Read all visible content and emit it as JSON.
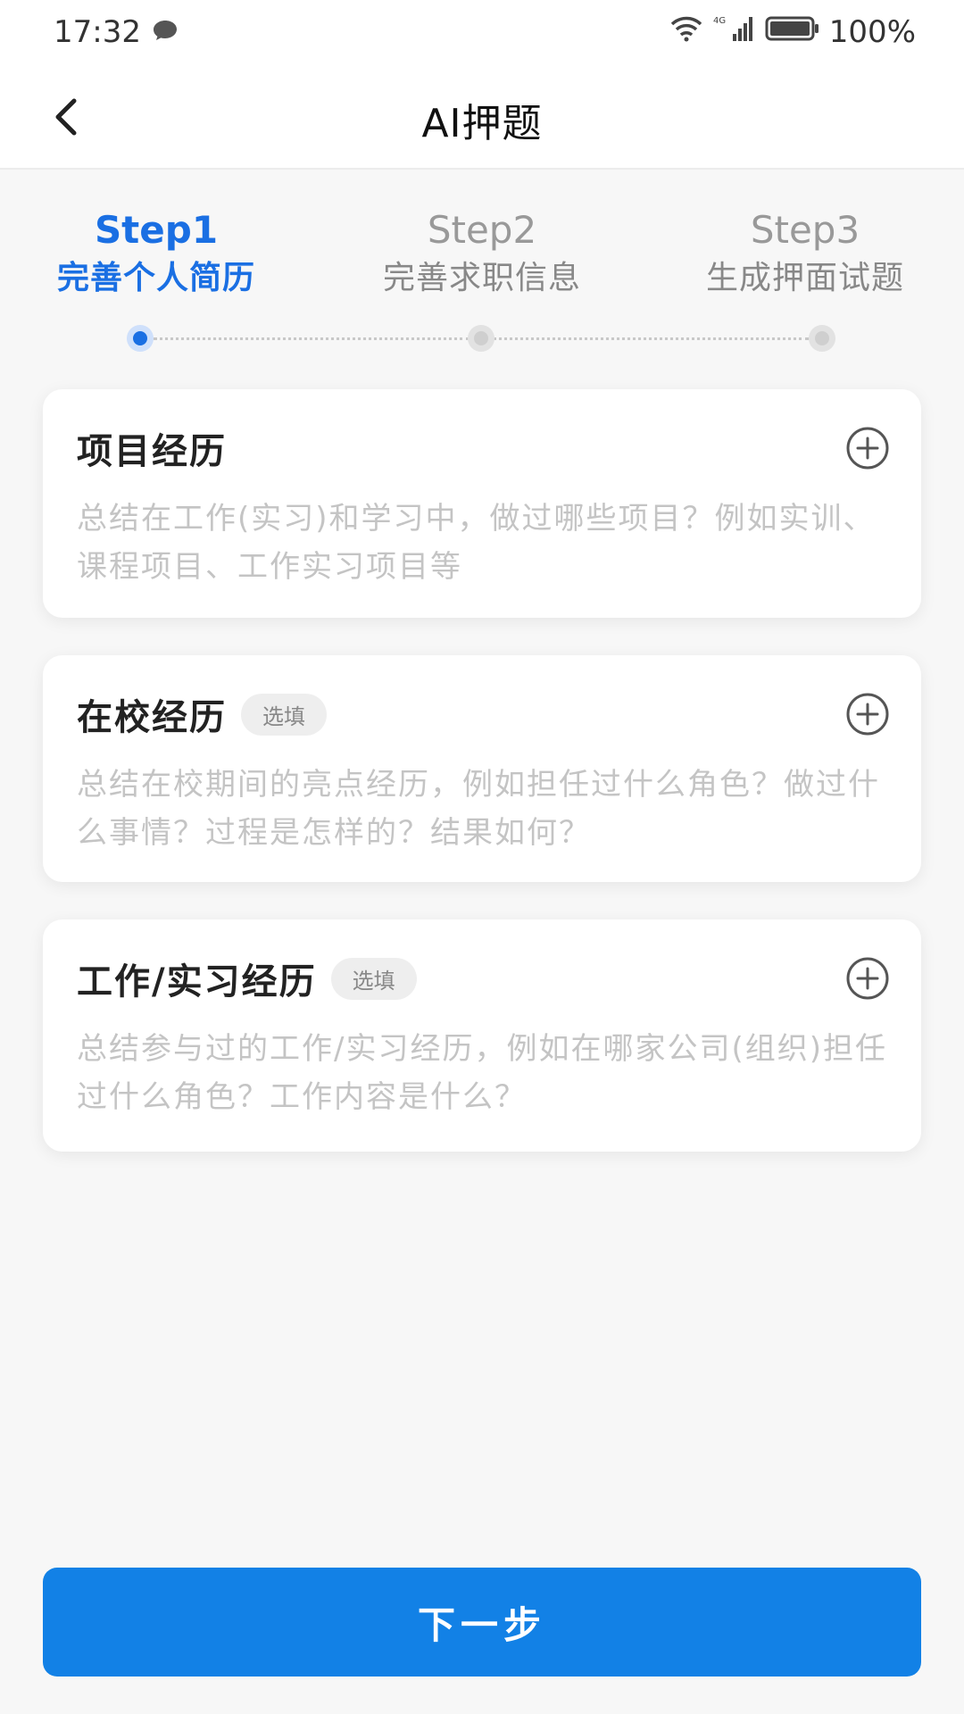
{
  "status_bar": {
    "time": "17:32",
    "battery": "100%",
    "network": "4G",
    "icons": [
      "message-icon",
      "wifi-icon",
      "signal-icon",
      "battery-icon"
    ]
  },
  "header": {
    "title": "AI押题",
    "back_icon": "chevron-left-icon"
  },
  "steps": [
    {
      "num": "Step1",
      "label": "完善个人简历",
      "active": true
    },
    {
      "num": "Step2",
      "label": "完善求职信息",
      "active": false
    },
    {
      "num": "Step3",
      "label": "生成押面试题",
      "active": false
    }
  ],
  "sections": [
    {
      "title": "项目经历",
      "badge": "",
      "description": "总结在工作(实习)和学习中，做过哪些项目？例如实训、课程项目、工作实习项目等",
      "icon": "plus-circle-icon"
    },
    {
      "title": "在校经历",
      "badge": "选填",
      "description": "总结在校期间的亮点经历，例如担任过什么角色？做过什么事情？过程是怎样的？结果如何？",
      "icon": "plus-circle-icon"
    },
    {
      "title": "工作/实习经历",
      "badge": "选填",
      "description": "总结参与过的工作/实习经历，例如在哪家公司(组织)担任过什么角色？工作内容是什么？",
      "icon": "plus-circle-icon"
    }
  ],
  "footer": {
    "next_label": "下一步"
  },
  "colors": {
    "accent": "#1a6fe3",
    "button": "#1281e6",
    "background": "#f7f7f7",
    "placeholder_text": "#c4c4c4"
  }
}
